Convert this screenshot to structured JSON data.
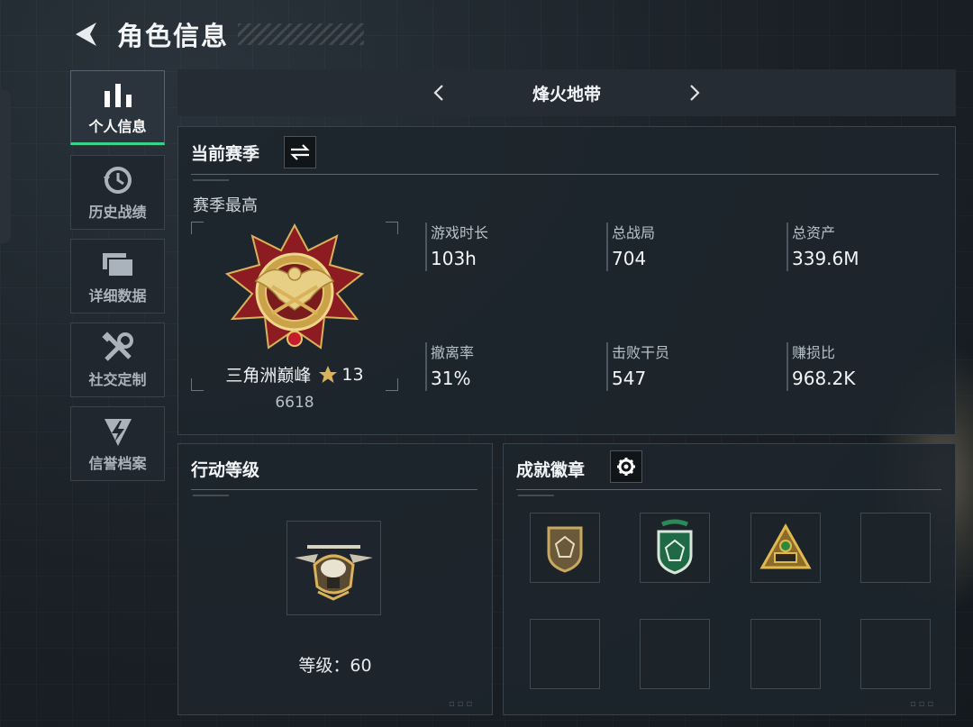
{
  "header": {
    "title": "角色信息"
  },
  "sidebar": {
    "items": [
      {
        "label": "个人信息",
        "icon": "bar-chart-icon",
        "active": true
      },
      {
        "label": "历史战绩",
        "icon": "history-clock-icon",
        "active": false
      },
      {
        "label": "详细数据",
        "icon": "folders-icon",
        "active": false
      },
      {
        "label": "社交定制",
        "icon": "tools-icon",
        "active": false
      },
      {
        "label": "信誉档案",
        "icon": "lightning-shield-icon",
        "active": false
      }
    ]
  },
  "mode": {
    "name": "烽火地带"
  },
  "season": {
    "title": "当前赛季",
    "best_label": "赛季最高",
    "rank_name": "三角洲巅峰",
    "rank_stars": "13",
    "rank_score": "6618",
    "stats": [
      {
        "label": "游戏时长",
        "value": "103h"
      },
      {
        "label": "总战局",
        "value": "704"
      },
      {
        "label": "总资产",
        "value": "339.6M"
      },
      {
        "label": "撤离率",
        "value": "31%"
      },
      {
        "label": "击败干员",
        "value": "547"
      },
      {
        "label": "赚损比",
        "value": "968.2K"
      }
    ]
  },
  "action_level": {
    "title": "行动等级",
    "level_text": "等级：60"
  },
  "achievements": {
    "title": "成就徽章",
    "badges": [
      "bronze-shield-badge-icon",
      "green-shield-badge-icon",
      "gold-triangle-badge-icon",
      "",
      "",
      "",
      "",
      ""
    ]
  },
  "colors": {
    "accent_green": "#35d48a",
    "gold": "#d9b25a",
    "crimson": "#8c1c22"
  }
}
